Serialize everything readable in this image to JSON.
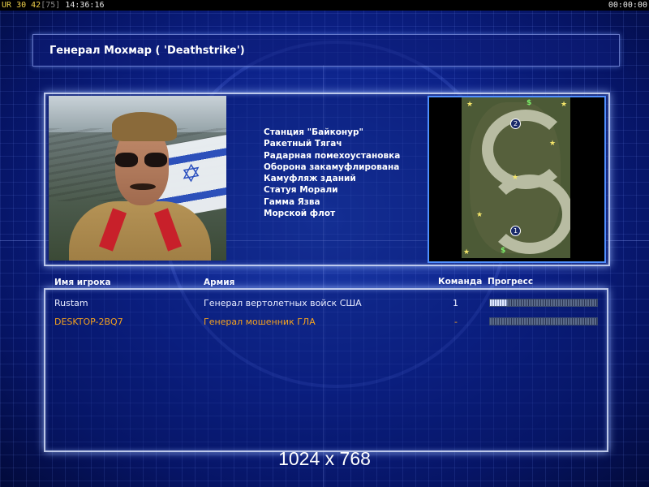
{
  "status": {
    "left_prefix": "UR",
    "left_a": "30",
    "left_b": "42",
    "left_bracket": "[75]",
    "clock": "14:36:16",
    "timer": "00:00:00"
  },
  "title": "Генерал Мохмар ( 'Deathstrike')",
  "features": [
    "Станция \"Байконур\"",
    "Ракетный Тягач",
    "Радарная помехоустановка",
    "Оборона закамуфлирована",
    "Камуфляж зданий",
    "Статуя Морали",
    "Гамма Язва",
    "Морской флот"
  ],
  "minimap": {
    "start_positions": [
      "1",
      "2"
    ],
    "dollar_icon": "$",
    "star_icon": "★"
  },
  "table": {
    "headers": {
      "player": "Имя игрока",
      "army": "Армия",
      "team": "Команда",
      "progress": "Прогресс"
    },
    "rows": [
      {
        "player": "Rustam",
        "army": "Генерал вертолетных войск США",
        "team": "1",
        "progress": 0.16,
        "color": "#e8ecff"
      },
      {
        "player": "DESKTOP-2BQ7",
        "army": "Генерал мошенник ГЛА",
        "team": "-",
        "progress": 0,
        "color": "#f5a21e"
      }
    ]
  },
  "resolution": "1024 x 768"
}
